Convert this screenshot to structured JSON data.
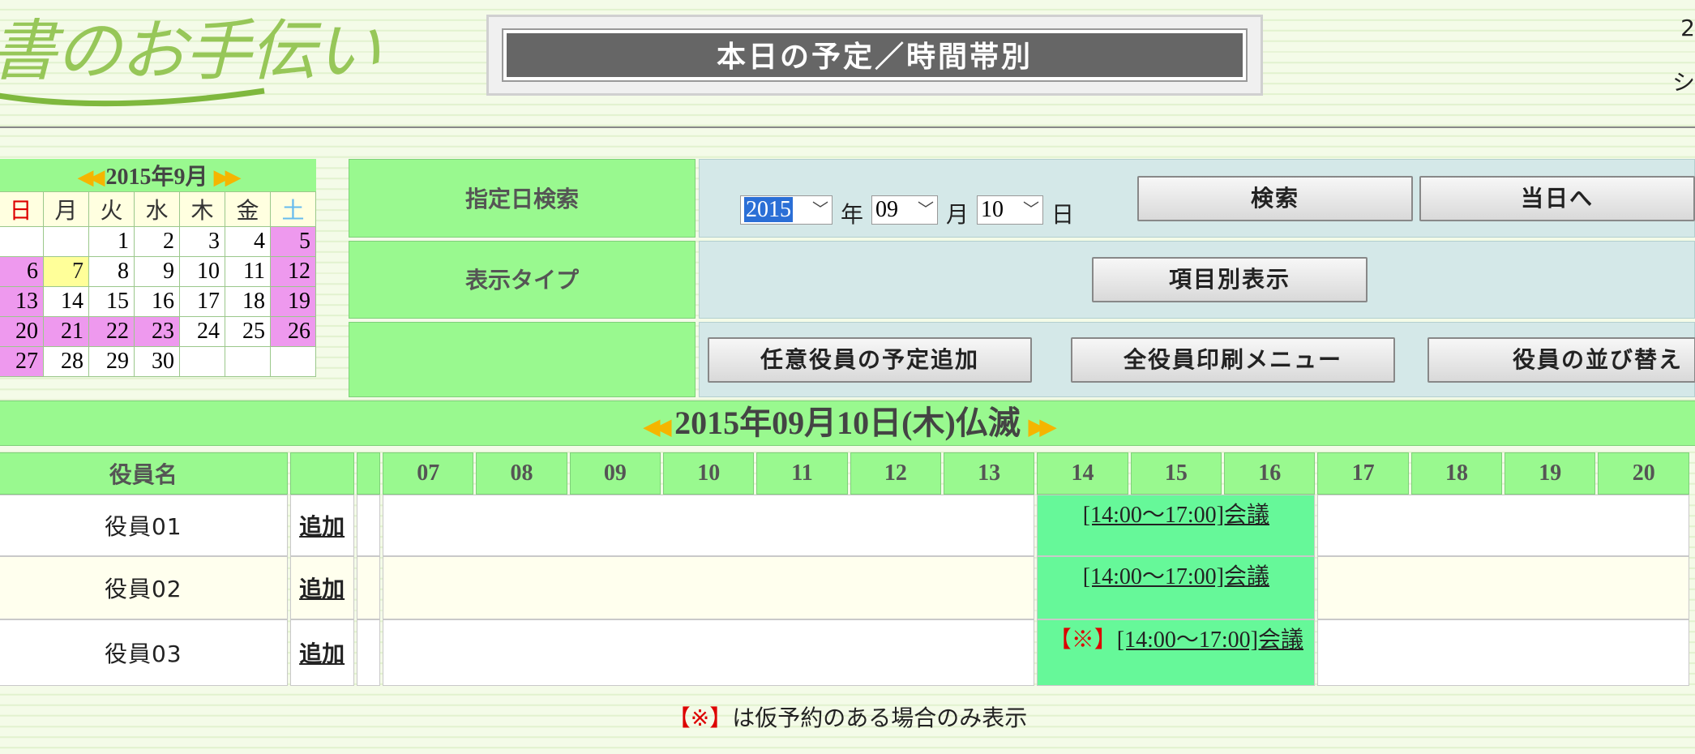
{
  "header": {
    "logo_text": "書のお手伝い",
    "title": "本日の予定／時間帯別",
    "corner_top": "2",
    "corner_bottom": "シ"
  },
  "mini_calendar": {
    "caption": "2015年9月",
    "weekdays": [
      "日",
      "月",
      "火",
      "水",
      "木",
      "金",
      "土"
    ],
    "weeks": [
      [
        "",
        "",
        "1",
        "2",
        "3",
        "4",
        "5"
      ],
      [
        "6",
        "7",
        "8",
        "9",
        "10",
        "11",
        "12"
      ],
      [
        "13",
        "14",
        "15",
        "16",
        "17",
        "18",
        "19"
      ],
      [
        "20",
        "21",
        "22",
        "23",
        "24",
        "25",
        "26"
      ],
      [
        "27",
        "28",
        "29",
        "30",
        "",
        "",
        ""
      ]
    ]
  },
  "search": {
    "label": "指定日検索",
    "year": "2015",
    "year_unit": "年",
    "month": "09",
    "month_unit": "月",
    "day": "10",
    "day_unit": "日",
    "search_button": "検索",
    "today_button": "当日へ"
  },
  "display_type": {
    "label": "表示タイプ",
    "button": "項目別表示"
  },
  "actions": {
    "add_schedule": "任意役員の予定追加",
    "print_menu": "全役員印刷メニュー",
    "reorder": "役員の並び替え"
  },
  "date_heading": "2015年09月10日(木)仏滅",
  "schedule": {
    "name_header": "役員名",
    "hours": [
      "07",
      "08",
      "09",
      "10",
      "11",
      "12",
      "13",
      "14",
      "15",
      "16",
      "17",
      "18",
      "19",
      "20"
    ],
    "rows": [
      {
        "name": "役員01",
        "add": "追加",
        "event": "[14:00〜17:00]会議",
        "mark": ""
      },
      {
        "name": "役員02",
        "add": "追加",
        "event": "[14:00〜17:00]会議",
        "mark": ""
      },
      {
        "name": "役員03",
        "add": "追加",
        "event": "[14:00〜17:00]会議",
        "mark": "【※】"
      }
    ]
  },
  "footnote_mark": "【※】",
  "footnote_text": "は仮予約のある場合のみ表示",
  "colors": {
    "header_green": "#99f98f",
    "event_green": "#66f899",
    "holiday_pink": "#ee99ee",
    "today_yellow": "#ffff99",
    "control_blue": "#d4e8e8"
  }
}
